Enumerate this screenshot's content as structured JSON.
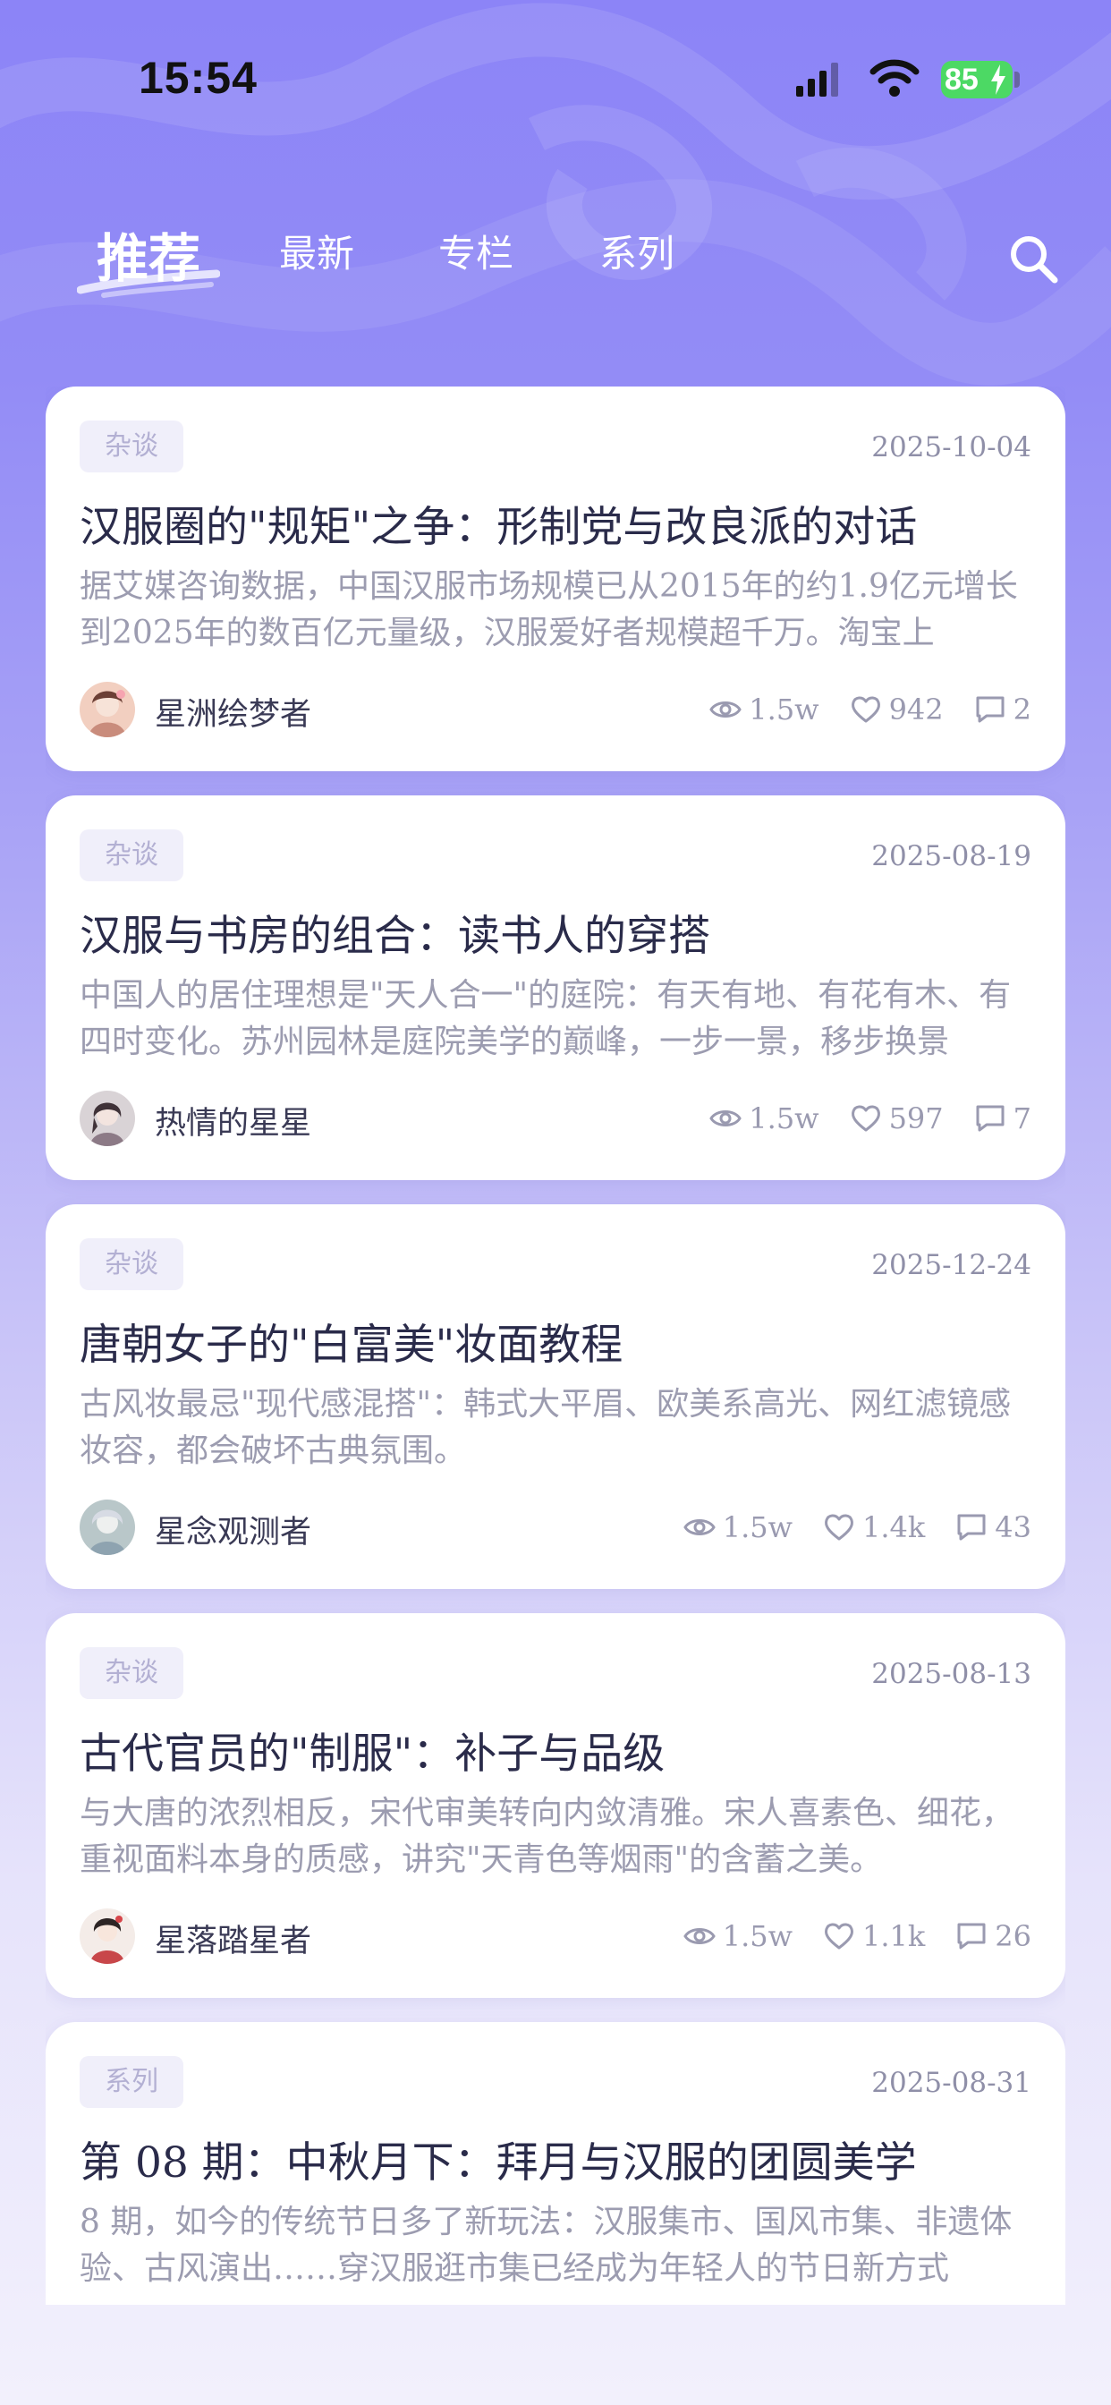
{
  "status_bar": {
    "time": "15:54",
    "battery": "85"
  },
  "tabs": [
    {
      "label": "推荐",
      "active": true
    },
    {
      "label": "最新"
    },
    {
      "label": "专栏"
    },
    {
      "label": "系列"
    }
  ],
  "search": {
    "icon": "search-icon"
  },
  "colors": {
    "accent": "#8c84f7",
    "battery": "#4cd964",
    "title": "#2a2b4a"
  },
  "articles": [
    {
      "tag": "杂谈",
      "date": "2025-10-04",
      "title": "汉服圈的\"规矩\"之争：形制党与改良派的对话",
      "description": "据艾媒咨询数据，中国汉服市场规模已从2015年的约1.9亿元增长到2025年的数百亿元量级，汉服爱好者规模超千万。淘宝上",
      "author": "星洲绘梦者",
      "views": "1.5w",
      "likes": "942",
      "comments": "2"
    },
    {
      "tag": "杂谈",
      "date": "2025-08-19",
      "title": "汉服与书房的组合：读书人的穿搭",
      "description": "中国人的居住理想是\"天人合一\"的庭院：有天有地、有花有木、有四时变化。苏州园林是庭院美学的巅峰，一步一景，移步换景",
      "author": "热情的星星",
      "views": "1.5w",
      "likes": "597",
      "comments": "7"
    },
    {
      "tag": "杂谈",
      "date": "2025-12-24",
      "title": "唐朝女子的\"白富美\"妆面教程",
      "description": "古风妆最忌\"现代感混搭\"：韩式大平眉、欧美系高光、网红滤镜感妆容，都会破坏古典氛围。",
      "author": "星念观测者",
      "views": "1.5w",
      "likes": "1.4k",
      "comments": "43"
    },
    {
      "tag": "杂谈",
      "date": "2025-08-13",
      "title": "古代官员的\"制服\"：补子与品级",
      "description": "与大唐的浓烈相反，宋代审美转向内敛清雅。宋人喜素色、细花，重视面料本身的质感，讲究\"天青色等烟雨\"的含蓄之美。",
      "author": "星落踏星者",
      "views": "1.5w",
      "likes": "1.1k",
      "comments": "26"
    },
    {
      "tag": "系列",
      "date": "2025-08-31",
      "title": "第 08 期：中秋月下：拜月与汉服的团圆美学",
      "description": "8 期，如今的传统节日多了新玩法：汉服集市、国风市集、非遗体验、古风演出……穿汉服逛市集已经成为年轻人的节日新方式",
      "author": "",
      "views": "",
      "likes": "",
      "comments": ""
    }
  ]
}
